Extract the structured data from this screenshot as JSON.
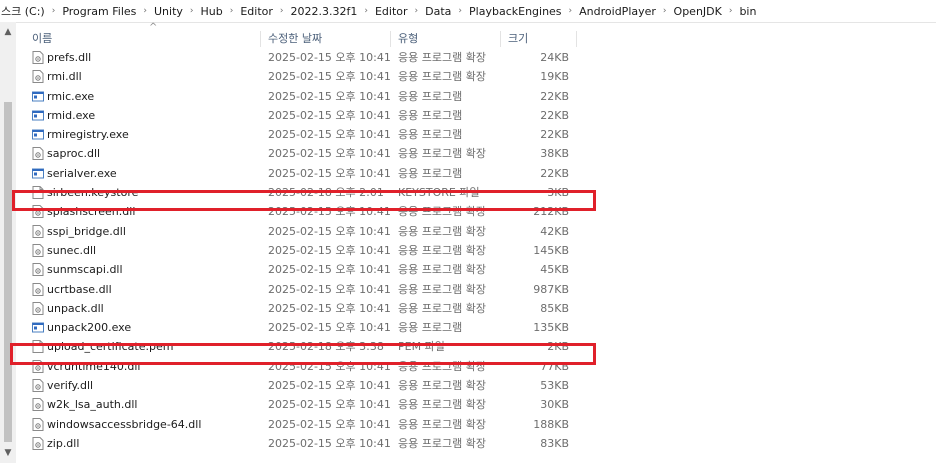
{
  "address_bar": {
    "crumbs": [
      "스크 (C:)",
      "Program Files",
      "Unity",
      "Hub",
      "Editor",
      "2022.3.32f1",
      "Editor",
      "Data",
      "PlaybackEngines",
      "AndroidPlayer",
      "OpenJDK",
      "bin"
    ],
    "separator": "›"
  },
  "columns": {
    "name": "이름",
    "date": "수정한 날짜",
    "type": "유형",
    "size": "크기",
    "sort_indicator": "^"
  },
  "files": [
    {
      "name": "prefs.dll",
      "date": "2025-02-15 오후 10:41",
      "type": "응용 프로그램 확장",
      "size": "24KB",
      "icon": "dll-icon"
    },
    {
      "name": "rmi.dll",
      "date": "2025-02-15 오후 10:41",
      "type": "응용 프로그램 확장",
      "size": "19KB",
      "icon": "dll-icon"
    },
    {
      "name": "rmic.exe",
      "date": "2025-02-15 오후 10:41",
      "type": "응용 프로그램",
      "size": "22KB",
      "icon": "exe-icon"
    },
    {
      "name": "rmid.exe",
      "date": "2025-02-15 오후 10:41",
      "type": "응용 프로그램",
      "size": "22KB",
      "icon": "exe-icon"
    },
    {
      "name": "rmiregistry.exe",
      "date": "2025-02-15 오후 10:41",
      "type": "응용 프로그램",
      "size": "22KB",
      "icon": "exe-icon"
    },
    {
      "name": "saproc.dll",
      "date": "2025-02-15 오후 10:41",
      "type": "응용 프로그램 확장",
      "size": "38KB",
      "icon": "dll-icon"
    },
    {
      "name": "serialver.exe",
      "date": "2025-02-15 오후 10:41",
      "type": "응용 프로그램",
      "size": "22KB",
      "icon": "exe-icon"
    },
    {
      "name": "sirbeen.keystore",
      "date": "2025-02-18 오후 2:01",
      "type": "KEYSTORE 파일",
      "size": "3KB",
      "icon": "file-icon"
    },
    {
      "name": "splashscreen.dll",
      "date": "2025-02-15 오후 10:41",
      "type": "응용 프로그램 확장",
      "size": "212KB",
      "icon": "dll-icon"
    },
    {
      "name": "sspi_bridge.dll",
      "date": "2025-02-15 오후 10:41",
      "type": "응용 프로그램 확장",
      "size": "42KB",
      "icon": "dll-icon"
    },
    {
      "name": "sunec.dll",
      "date": "2025-02-15 오후 10:41",
      "type": "응용 프로그램 확장",
      "size": "145KB",
      "icon": "dll-icon"
    },
    {
      "name": "sunmscapi.dll",
      "date": "2025-02-15 오후 10:41",
      "type": "응용 프로그램 확장",
      "size": "45KB",
      "icon": "dll-icon"
    },
    {
      "name": "ucrtbase.dll",
      "date": "2025-02-15 오후 10:41",
      "type": "응용 프로그램 확장",
      "size": "987KB",
      "icon": "dll-icon"
    },
    {
      "name": "unpack.dll",
      "date": "2025-02-15 오후 10:41",
      "type": "응용 프로그램 확장",
      "size": "85KB",
      "icon": "dll-icon"
    },
    {
      "name": "unpack200.exe",
      "date": "2025-02-15 오후 10:41",
      "type": "응용 프로그램",
      "size": "135KB",
      "icon": "exe-icon"
    },
    {
      "name": "upload_certificate.pem",
      "date": "2025-02-18 오후 3:38",
      "type": "PEM 파일",
      "size": "2KB",
      "icon": "file-icon"
    },
    {
      "name": "vcruntime140.dll",
      "date": "2025-02-15 오후 10:41",
      "type": "응용 프로그램 확장",
      "size": "77KB",
      "icon": "dll-icon"
    },
    {
      "name": "verify.dll",
      "date": "2025-02-15 오후 10:41",
      "type": "응용 프로그램 확장",
      "size": "53KB",
      "icon": "dll-icon"
    },
    {
      "name": "w2k_lsa_auth.dll",
      "date": "2025-02-15 오후 10:41",
      "type": "응용 프로그램 확장",
      "size": "30KB",
      "icon": "dll-icon"
    },
    {
      "name": "windowsaccessbridge-64.dll",
      "date": "2025-02-15 오후 10:41",
      "type": "응용 프로그램 확장",
      "size": "188KB",
      "icon": "dll-icon"
    },
    {
      "name": "zip.dll",
      "date": "2025-02-15 오후 10:41",
      "type": "응용 프로그램 확장",
      "size": "83KB",
      "icon": "dll-icon"
    }
  ],
  "colors": {
    "highlight": "#e0202a",
    "header_text": "#4c607a",
    "meta_text": "#6d6d6d"
  }
}
